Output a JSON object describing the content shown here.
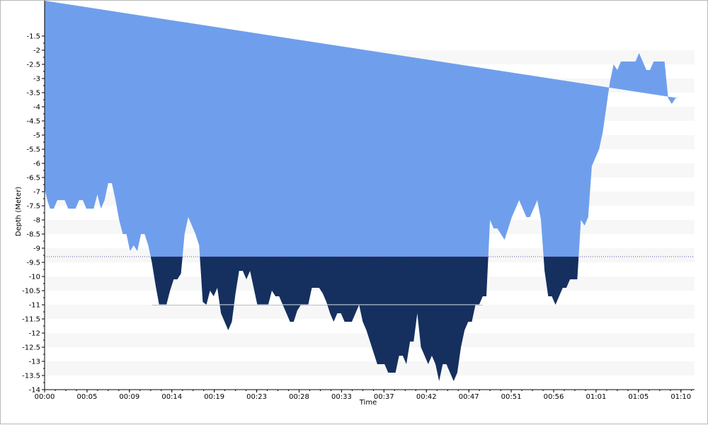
{
  "chart_data": {
    "type": "area",
    "title": "",
    "xlabel": "Time",
    "ylabel": "Depth (Meter)",
    "y_inverted": true,
    "ylim": [
      -14,
      -1
    ],
    "y_ticks": [
      -1.5,
      -2,
      -2.5,
      -3,
      -3.5,
      -4,
      -4.5,
      -5,
      -5.5,
      -6,
      -6.5,
      -7,
      -7.5,
      -8,
      -8.5,
      -9,
      -9.5,
      -10,
      -10.5,
      -11,
      -11.5,
      -12,
      -12.5,
      -13,
      -13.5,
      -14
    ],
    "y_tick_labels": [
      "-1.5",
      "-2",
      "-2.5",
      "-3",
      "-3.5",
      "-4",
      "-4.5",
      "-5",
      "-5.5",
      "-6",
      "-6.5",
      "-7",
      "-7.5",
      "-8",
      "-8.5",
      "-9",
      "-9.5",
      "-10",
      "-10.5",
      "-11",
      "-11.5",
      "-12",
      "-12.5",
      "-13",
      "-13.5",
      "-14"
    ],
    "xlim_minutes": [
      0,
      71.5
    ],
    "x_ticks_minutes": [
      0,
      4.67,
      9.33,
      14,
      18.67,
      23.33,
      28,
      32.67,
      37.33,
      42,
      46.67,
      51.33,
      56,
      60.67,
      65.33,
      70
    ],
    "x_tick_labels": [
      "00:00",
      "00:05",
      "00:09",
      "00:14",
      "00:19",
      "00:23",
      "00:28",
      "00:33",
      "00:37",
      "00:42",
      "00:47",
      "00:51",
      "00:56",
      "01:01",
      "01:05",
      "01:10"
    ],
    "threshold_depth": -9.3,
    "reference_line": {
      "depth": -11,
      "from_minute": 11.8,
      "to_minute": 48.2
    },
    "grid": "alternating horizontal bands",
    "colors": {
      "shallow_fill": "#6f9fec",
      "deep_fill": "#15305f",
      "band": "#f7f7f7",
      "threshold_line": "#6050a0",
      "reference_line": "#15305f"
    },
    "series": [
      {
        "x": [
          0,
          0.3,
          0.6,
          1.0,
          1.4,
          1.8,
          2.2,
          2.6,
          3.0,
          3.4,
          3.8,
          4.2,
          4.6,
          5.0,
          5.4,
          5.8,
          6.2,
          6.6,
          7.0,
          7.4,
          7.8,
          8.2,
          8.6,
          9.0,
          9.4,
          9.8,
          10.2,
          10.6,
          11.0,
          11.4,
          11.8,
          12.2,
          12.6,
          13.0,
          13.4,
          13.8,
          14.2,
          14.6,
          15.0,
          15.4,
          15.8,
          16.2,
          16.6,
          17.0,
          17.4,
          17.8,
          18.2,
          18.6,
          19.0,
          19.4,
          19.8,
          20.2,
          20.6,
          21.0,
          21.4,
          21.8,
          22.2,
          22.6,
          23.0,
          23.4,
          23.8,
          24.2,
          24.6,
          25.0,
          25.4,
          25.8,
          26.2,
          26.6,
          27.0,
          27.4,
          27.8,
          28.2,
          28.6,
          29.0,
          29.4,
          29.8,
          30.2,
          30.6,
          31.0,
          31.4,
          31.8,
          32.2,
          32.6,
          33.0,
          33.4,
          33.8,
          34.2,
          34.6,
          35.0,
          35.4,
          35.8,
          36.2,
          36.6,
          37.0,
          37.4,
          37.8,
          38.2,
          38.6,
          39.0,
          39.4,
          39.8,
          40.2,
          40.6,
          41.0,
          41.4,
          41.8,
          42.2,
          42.6,
          43.0,
          43.4,
          43.8,
          44.2,
          44.6,
          45.0,
          45.4,
          45.8,
          46.2,
          46.6,
          47.0,
          47.4,
          47.8,
          48.2,
          48.6,
          49.0,
          49.4,
          49.8,
          50.2,
          50.6,
          51.0,
          51.4,
          51.8,
          52.2,
          52.6,
          53.0,
          53.4,
          53.8,
          54.2,
          54.6,
          55.0,
          55.4,
          55.8,
          56.2,
          56.6,
          57.0,
          57.4,
          57.8,
          58.2,
          58.6,
          59.0,
          59.4,
          59.8,
          60.2,
          60.6,
          61.0,
          61.4,
          61.8,
          62.2,
          62.6,
          63.0,
          63.4,
          63.8,
          64.2,
          64.6,
          65.0,
          65.4,
          65.8,
          66.2,
          66.6,
          67.0,
          67.4,
          67.8,
          68.2,
          68.6,
          69.0,
          69.4,
          69.8,
          70.2,
          70.6,
          71.0,
          71.5
        ],
        "depth": [
          -6.9,
          -7.3,
          -7.6,
          -7.6,
          -7.3,
          -7.3,
          -7.3,
          -7.6,
          -7.6,
          -7.6,
          -7.3,
          -7.3,
          -7.6,
          -7.6,
          -7.6,
          -7.1,
          -7.6,
          -7.3,
          -6.7,
          -6.7,
          -7.3,
          -8.0,
          -8.5,
          -8.5,
          -9.1,
          -8.9,
          -9.1,
          -8.5,
          -8.5,
          -8.9,
          -9.5,
          -10.3,
          -11.0,
          -11.0,
          -11.0,
          -10.5,
          -10.1,
          -10.1,
          -9.9,
          -8.5,
          -7.9,
          -8.2,
          -8.5,
          -8.9,
          -10.9,
          -11.0,
          -10.5,
          -10.7,
          -10.4,
          -11.3,
          -11.6,
          -11.9,
          -11.6,
          -10.6,
          -9.8,
          -9.8,
          -10.1,
          -9.8,
          -10.4,
          -11.0,
          -11.0,
          -11.0,
          -11.0,
          -10.5,
          -10.7,
          -10.7,
          -11.0,
          -11.3,
          -11.6,
          -11.6,
          -11.2,
          -11.0,
          -11.0,
          -11.0,
          -10.4,
          -10.4,
          -10.4,
          -10.6,
          -10.9,
          -11.3,
          -11.6,
          -11.3,
          -11.3,
          -11.6,
          -11.6,
          -11.6,
          -11.3,
          -11.0,
          -11.6,
          -11.9,
          -12.3,
          -12.7,
          -13.1,
          -13.1,
          -13.1,
          -13.4,
          -13.4,
          -13.4,
          -12.8,
          -12.8,
          -13.1,
          -12.3,
          -12.3,
          -11.3,
          -12.5,
          -12.8,
          -13.1,
          -12.8,
          -13.1,
          -13.7,
          -13.1,
          -13.1,
          -13.4,
          -13.7,
          -13.4,
          -12.5,
          -11.9,
          -11.6,
          -11.6,
          -11.0,
          -11.0,
          -10.7,
          -10.7,
          -8.0,
          -8.3,
          -8.3,
          -8.5,
          -8.7,
          -8.3,
          -7.9,
          -7.6,
          -7.3,
          -7.6,
          -7.9,
          -7.9,
          -7.6,
          -7.3,
          -8.0,
          -9.8,
          -10.7,
          -10.7,
          -11.0,
          -10.7,
          -10.4,
          -10.4,
          -10.1,
          -10.1,
          -10.1,
          -8.0,
          -8.2,
          -7.9,
          -6.1,
          -5.8,
          -5.5,
          -4.9,
          -4.0,
          -3.1,
          -2.5,
          -2.7,
          -2.4,
          -2.4,
          -2.4,
          -2.4,
          -2.4,
          -2.1,
          -2.4,
          -2.7,
          -2.7,
          -2.4,
          -2.4,
          -2.4,
          -2.4,
          -3.7,
          -3.9,
          -3.7,
          -3.7
        ]
      }
    ]
  }
}
